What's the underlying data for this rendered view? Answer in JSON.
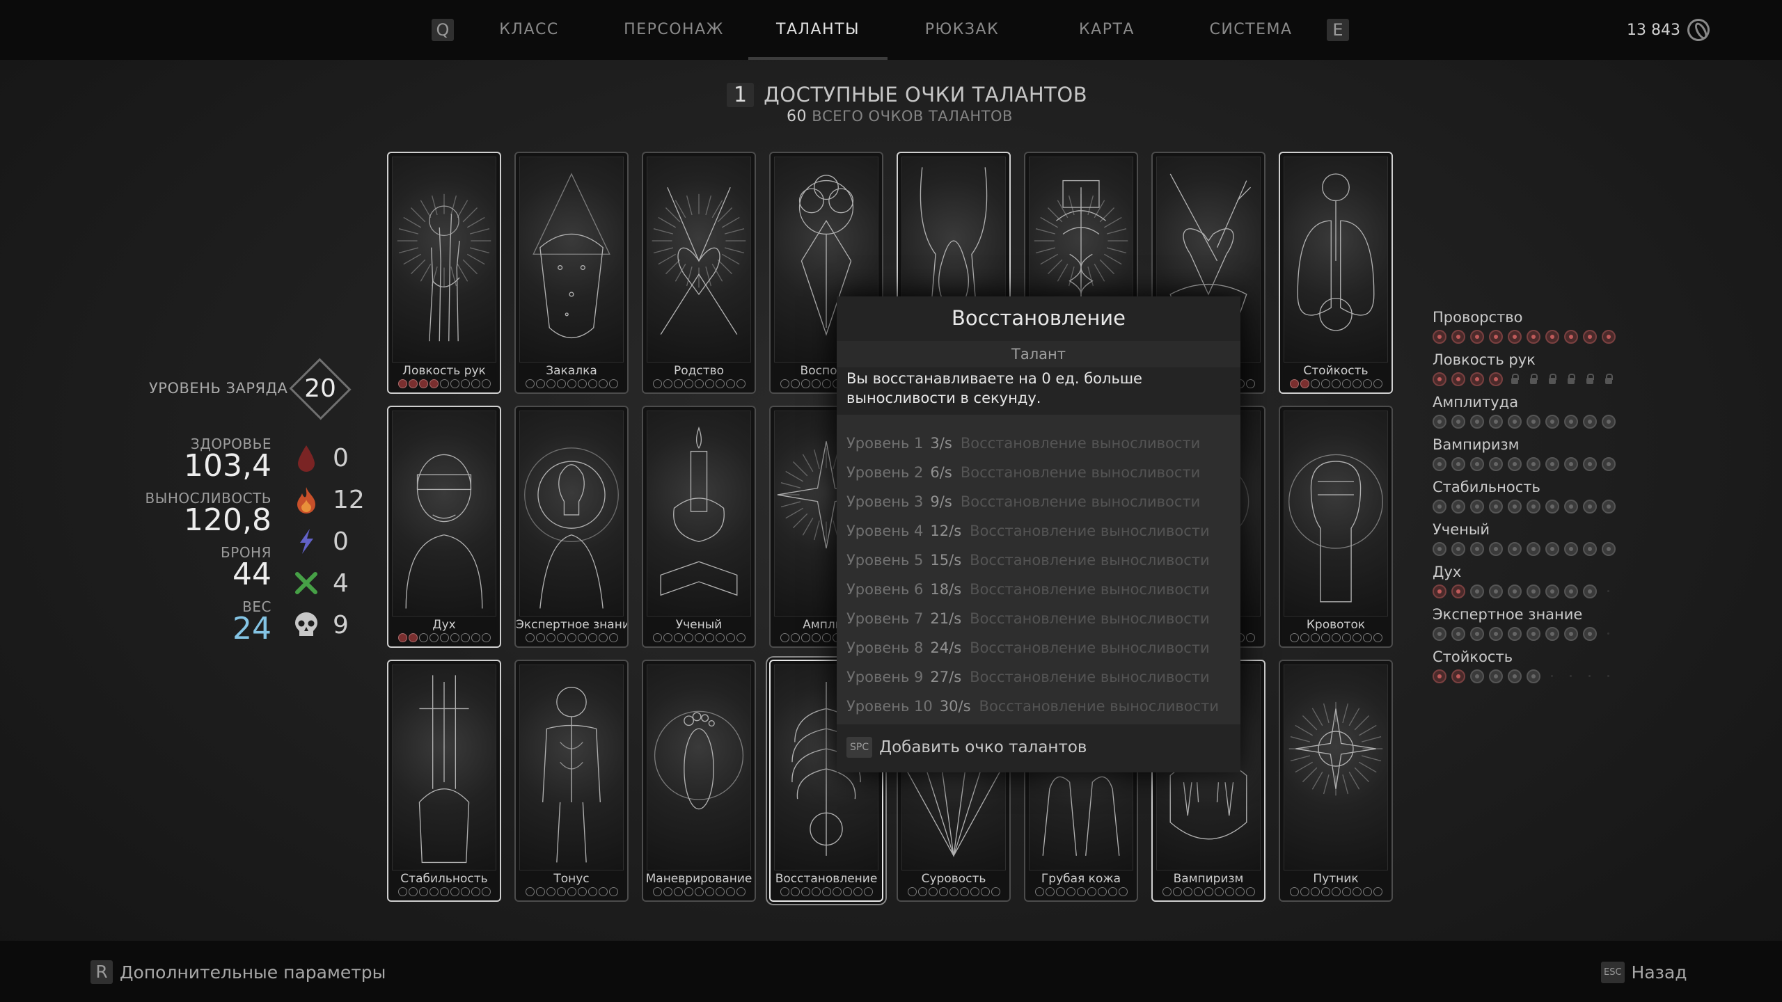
{
  "nav": {
    "key_left": "Q",
    "key_right": "E",
    "tabs": [
      {
        "label": "КЛАСС",
        "active": false
      },
      {
        "label": "ПЕРСОНАЖ",
        "active": false
      },
      {
        "label": "ТАЛАНТЫ",
        "active": true
      },
      {
        "label": "РЮКЗАК",
        "active": false
      },
      {
        "label": "КАРТА",
        "active": false
      },
      {
        "label": "СИСТЕМА",
        "active": false
      }
    ],
    "currency": "13 843"
  },
  "header": {
    "available_points": "1",
    "available_label": "ДОСТУПНЫЕ ОЧКИ ТАЛАНТОВ",
    "total_points": "60",
    "total_label": "ВСЕГО ОЧКОВ ТАЛАНТОВ"
  },
  "cards": [
    {
      "name": "Ловкость рук",
      "icon": "hand-icon",
      "filled": 4,
      "total": 9
    },
    {
      "name": "Закалка",
      "icon": "demon-icon",
      "filled": 0,
      "total": 9
    },
    {
      "name": "Родство",
      "icon": "heart-icon",
      "filled": 0,
      "total": 9
    },
    {
      "name": "Восполн",
      "icon": "tree-icon",
      "filled": 0,
      "total": 9
    },
    {
      "name": "",
      "icon": "wing-icon",
      "filled": 0,
      "total": 9
    },
    {
      "name": "",
      "icon": "caduceus-icon",
      "filled": 0,
      "total": 9
    },
    {
      "name": "",
      "icon": "sword-heart-icon",
      "filled": 0,
      "total": 9
    },
    {
      "name": "Стойкость",
      "icon": "lungs-icon",
      "filled": 2,
      "total": 9
    },
    {
      "name": "Дух",
      "icon": "blindfold-icon",
      "filled": 2,
      "total": 9
    },
    {
      "name": "Экспертное знание",
      "icon": "bulb-icon",
      "filled": 0,
      "total": 9
    },
    {
      "name": "Ученый",
      "icon": "candle-icon",
      "filled": 0,
      "total": 9
    },
    {
      "name": "Амплит",
      "icon": "star-icon",
      "filled": 0,
      "total": 9
    },
    {
      "name": "",
      "icon": "blank-icon",
      "filled": 0,
      "total": 9
    },
    {
      "name": "",
      "icon": "blank-icon",
      "filled": 0,
      "total": 9
    },
    {
      "name": "во",
      "icon": "blank-icon",
      "filled": 0,
      "total": 9
    },
    {
      "name": "Кровоток",
      "icon": "fist-icon",
      "filled": 0,
      "total": 9
    },
    {
      "name": "Стабильность",
      "icon": "sword-hand-icon",
      "filled": 0,
      "total": 9
    },
    {
      "name": "Тонус",
      "icon": "anatomy-icon",
      "filled": 0,
      "total": 9
    },
    {
      "name": "Маневрирование",
      "icon": "footprint-icon",
      "filled": 0,
      "total": 9
    },
    {
      "name": "Восстановление",
      "icon": "ribcage-icon",
      "filled": 0,
      "total": 9
    },
    {
      "name": "Суровость",
      "icon": "rays-icon",
      "filled": 0,
      "total": 9
    },
    {
      "name": "Грубая кожа",
      "icon": "hands-icon",
      "filled": 0,
      "total": 9
    },
    {
      "name": "Вампиризм",
      "icon": "fangs-icon",
      "filled": 0,
      "total": 9
    },
    {
      "name": "Путник",
      "icon": "compass-icon",
      "filled": 0,
      "total": 9
    }
  ],
  "stats": {
    "charge_label": "УРОВЕНЬ ЗАРЯДА",
    "charge_value": "20",
    "health_label": "ЗДОРОВЬЕ",
    "health_value": "103,4",
    "stamina_label": "ВЫНОСЛИВОСТЬ",
    "stamina_value": "120,8",
    "armor_label": "БРОНЯ",
    "armor_value": "44",
    "weight_label": "ВЕС",
    "weight_value": "24",
    "resists": [
      {
        "icon": "blood-drop-icon",
        "value": "0",
        "color": "#8a2a2a"
      },
      {
        "icon": "fire-icon",
        "value": "12",
        "color": "#c8502a"
      },
      {
        "icon": "lightning-icon",
        "value": "0",
        "color": "#6a6ad0"
      },
      {
        "icon": "crossed-bones-icon",
        "value": "4",
        "color": "#4aa84a"
      },
      {
        "icon": "skull-icon",
        "value": "9",
        "color": "#cccccc"
      }
    ]
  },
  "tooltip": {
    "title": "Восстановление",
    "type": "Талант",
    "description": "Вы восстанавливаете на 0 ед. больше выносливости в секунду.",
    "levels": [
      {
        "label": "Уровень 1",
        "value": "3/s",
        "text": "Восстановление выносливости"
      },
      {
        "label": "Уровень 2",
        "value": "6/s",
        "text": "Восстановление выносливости"
      },
      {
        "label": "Уровень 3",
        "value": "9/s",
        "text": "Восстановление выносливости"
      },
      {
        "label": "Уровень 4",
        "value": "12/s",
        "text": "Восстановление выносливости"
      },
      {
        "label": "Уровень 5",
        "value": "15/s",
        "text": "Восстановление выносливости"
      },
      {
        "label": "Уровень 6",
        "value": "18/s",
        "text": "Восстановление выносливости"
      },
      {
        "label": "Уровень 7",
        "value": "21/s",
        "text": "Восстановление выносливости"
      },
      {
        "label": "Уровень 8",
        "value": "24/s",
        "text": "Восстановление выносливости"
      },
      {
        "label": "Уровень 9",
        "value": "27/s",
        "text": "Восстановление выносливости"
      },
      {
        "label": "Уровень 10",
        "value": "30/s",
        "text": "Восстановление выносливости"
      }
    ],
    "footer_key": "SPC",
    "footer_label": "Добавить очко талантов"
  },
  "talent_list": [
    {
      "name": "Проворство",
      "dots": [
        "f",
        "f",
        "f",
        "f",
        "f",
        "f",
        "f",
        "f",
        "f",
        "f"
      ]
    },
    {
      "name": "Ловкость рук",
      "dots": [
        "f",
        "f",
        "f",
        "f",
        "l",
        "l",
        "l",
        "l",
        "l",
        "l"
      ]
    },
    {
      "name": "Амплитуда",
      "dots": [
        "e",
        "e",
        "e",
        "e",
        "e",
        "e",
        "e",
        "e",
        "e",
        "e"
      ]
    },
    {
      "name": "Вампиризм",
      "dots": [
        "e",
        "e",
        "e",
        "e",
        "e",
        "e",
        "e",
        "e",
        "e",
        "e"
      ]
    },
    {
      "name": "Стабильность",
      "dots": [
        "e",
        "e",
        "e",
        "e",
        "e",
        "e",
        "e",
        "e",
        "e",
        "e"
      ]
    },
    {
      "name": "Ученый",
      "dots": [
        "e",
        "e",
        "e",
        "e",
        "e",
        "e",
        "e",
        "e",
        "e",
        "e"
      ]
    },
    {
      "name": "Дух",
      "dots": [
        "f",
        "f",
        "e",
        "e",
        "e",
        "e",
        "e",
        "e",
        "e",
        "x"
      ]
    },
    {
      "name": "Экспертное знание",
      "dots": [
        "e",
        "e",
        "e",
        "e",
        "e",
        "e",
        "e",
        "e",
        "e",
        "x"
      ]
    },
    {
      "name": "Стойкость",
      "dots": [
        "f",
        "f",
        "e",
        "e",
        "e",
        "e",
        "x",
        "x",
        "x",
        "x"
      ]
    }
  ],
  "bottom": {
    "left_key": "R",
    "left_label": "Дополнительные параметры",
    "right_key": "ESC",
    "right_label": "Назад"
  }
}
